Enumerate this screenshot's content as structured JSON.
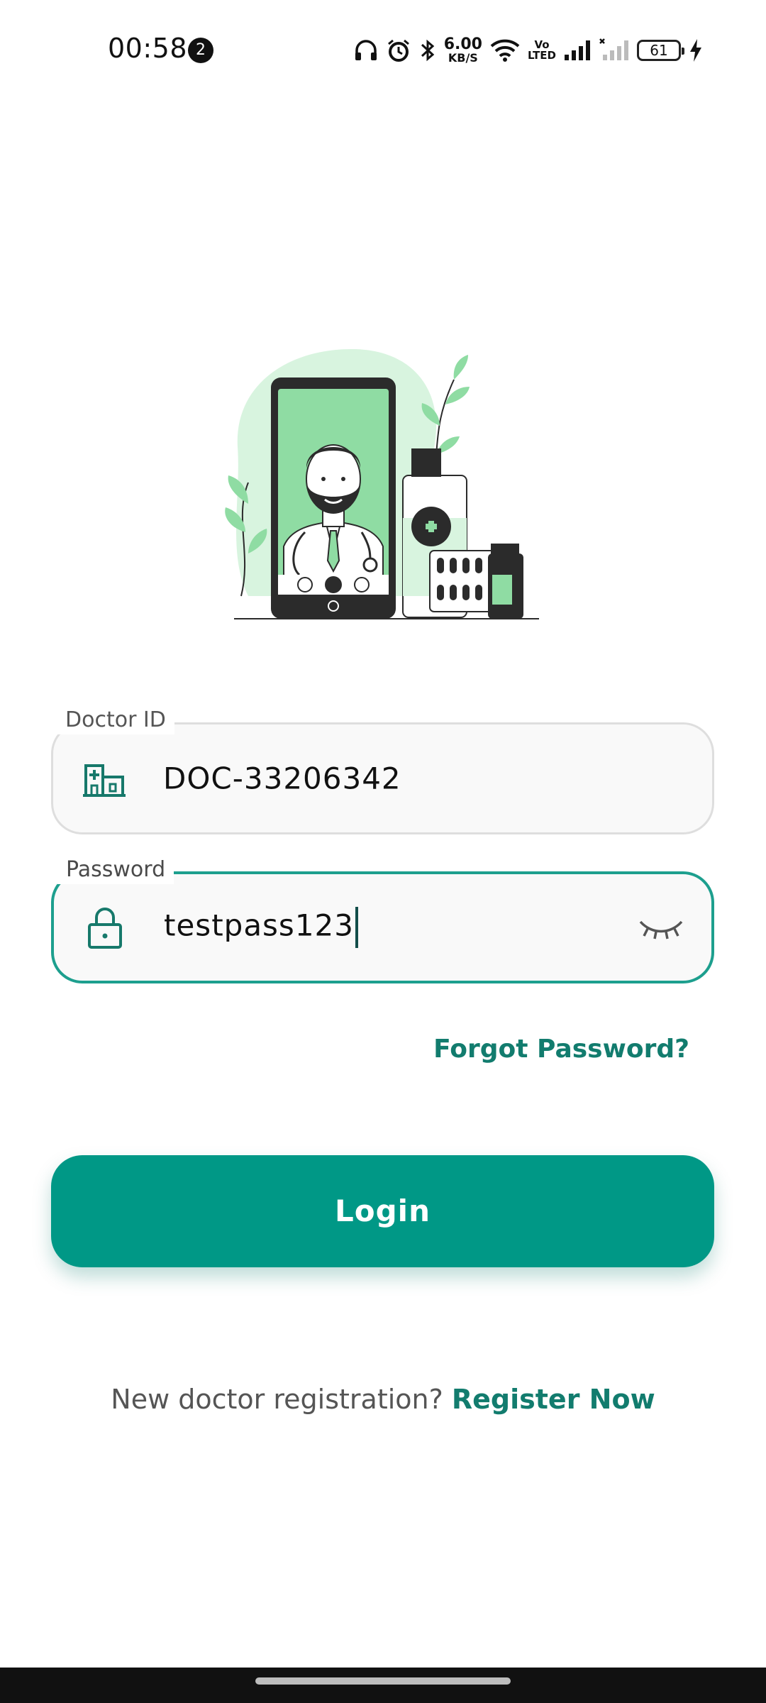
{
  "status_bar": {
    "time": "00:58",
    "notification_count": "2",
    "net_speed_value": "6.00",
    "net_speed_unit": "KB/S",
    "volte_top": "Vo",
    "volte_bottom": "LTED",
    "battery_level": "61",
    "icons": [
      "headphones-icon",
      "alarm-icon",
      "bluetooth-icon",
      "wifi-icon",
      "signal-icon",
      "signal-no-service-icon",
      "charging-icon"
    ]
  },
  "form": {
    "doctor_id": {
      "label": "Doctor ID",
      "value": "DOC-33206342",
      "icon": "hospital-icon"
    },
    "password": {
      "label": "Password",
      "value": "testpass123",
      "icon": "lock-icon",
      "toggle_icon": "eye-closed-icon"
    }
  },
  "forgot_password": "Forgot Password?",
  "login_button": "Login",
  "register": {
    "prompt": "New doctor registration?",
    "link": "Register Now"
  },
  "colors": {
    "accent": "#009886",
    "link": "#127c6e",
    "focus_border": "#1d9f8e",
    "illustration_green": "#8fdca3"
  }
}
